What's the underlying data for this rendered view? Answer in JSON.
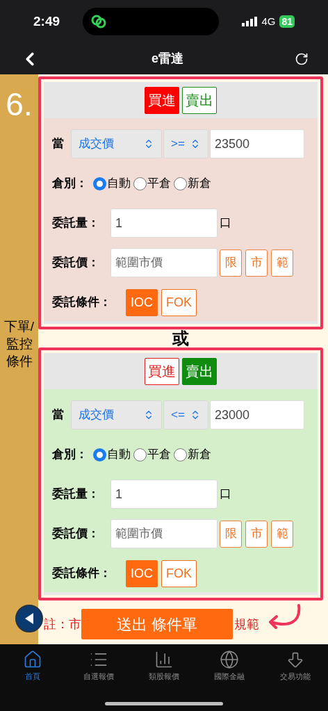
{
  "status_bar": {
    "time": "2:49",
    "network": "4G",
    "battery": "81"
  },
  "nav": {
    "title": "e雷達"
  },
  "step": {
    "number": "6.",
    "label": "下單/監控條件"
  },
  "conditions": [
    {
      "highlighted": true,
      "sides": [
        {
          "label": "買進",
          "kind": "buy",
          "selected": true
        },
        {
          "label": "賣出",
          "kind": "sell",
          "selected": false
        }
      ],
      "trigger_label": "當",
      "field": "成交價",
      "operator": ">=",
      "value": "23500",
      "position_label": "倉別：",
      "positions": [
        {
          "label": "自動",
          "selected": true
        },
        {
          "label": "平倉",
          "selected": false
        },
        {
          "label": "新倉",
          "selected": false
        }
      ],
      "qty_label": "委託量：",
      "qty": "1",
      "qty_unit": "口",
      "price_label": "委託價：",
      "price_placeholder": "範圍市價",
      "price_types": [
        "限",
        "市",
        "範"
      ],
      "tif_label": "委託條件：",
      "tif": [
        {
          "label": "IOC",
          "selected": true
        },
        {
          "label": "FOK",
          "selected": false
        }
      ]
    },
    {
      "highlighted": true,
      "sides": [
        {
          "label": "買進",
          "kind": "buy",
          "selected": false
        },
        {
          "label": "賣出",
          "kind": "sell",
          "selected": true
        }
      ],
      "trigger_label": "當",
      "field": "成交價",
      "operator": "<=",
      "value": "23000",
      "position_label": "倉別：",
      "positions": [
        {
          "label": "自動",
          "selected": true
        },
        {
          "label": "平倉",
          "selected": false
        },
        {
          "label": "新倉",
          "selected": false
        }
      ],
      "qty_label": "委託量：",
      "qty": "1",
      "qty_unit": "口",
      "price_label": "委託價：",
      "price_placeholder": "範圍市價",
      "price_types": [
        "限",
        "市",
        "範"
      ],
      "tif_label": "委託條件：",
      "tif": [
        {
          "label": "IOC",
          "selected": true
        },
        {
          "label": "FOK",
          "selected": false
        }
      ]
    }
  ],
  "separator": "或",
  "note_left": "註：市",
  "note_right": "規範",
  "submit": "送出 條件單",
  "tabs": [
    {
      "label": "首頁",
      "selected": true
    },
    {
      "label": "自選報價",
      "selected": false
    },
    {
      "label": "類股報價",
      "selected": false
    },
    {
      "label": "國際金融",
      "selected": false
    },
    {
      "label": "交易功能",
      "selected": false
    }
  ]
}
